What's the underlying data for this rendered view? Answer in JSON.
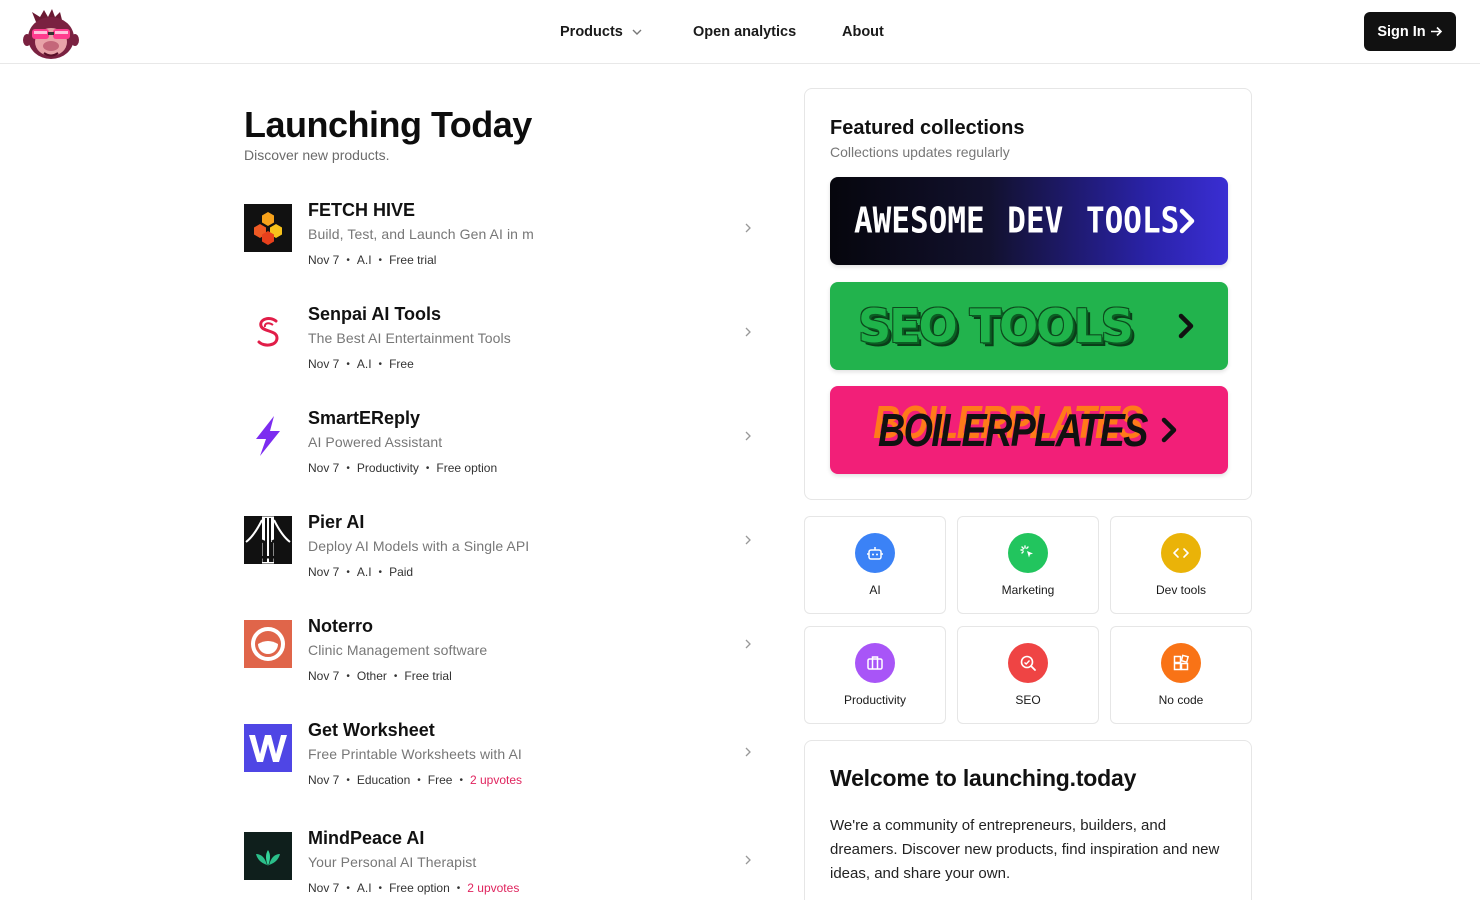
{
  "header": {
    "nav": {
      "products": "Products",
      "analytics": "Open analytics",
      "about": "About"
    },
    "signin": "Sign In"
  },
  "main": {
    "title": "Launching Today",
    "subtitle": "Discover new products.",
    "products": [
      {
        "name": "FETCH HIVE",
        "tagline": "Build, Test, and Launch Gen AI in m",
        "date": "Nov 7",
        "category": "A.I",
        "pricing": "Free trial",
        "upvotes": ""
      },
      {
        "name": "Senpai AI Tools",
        "tagline": "The Best AI Entertainment Tools",
        "date": "Nov 7",
        "category": "A.I",
        "pricing": "Free",
        "upvotes": ""
      },
      {
        "name": "SmartEReply",
        "tagline": "AI Powered Assistant",
        "date": "Nov 7",
        "category": "Productivity",
        "pricing": "Free option",
        "upvotes": ""
      },
      {
        "name": "Pier AI",
        "tagline": "Deploy AI Models with a Single API",
        "date": "Nov 7",
        "category": "A.I",
        "pricing": "Paid",
        "upvotes": ""
      },
      {
        "name": "Noterro",
        "tagline": "Clinic Management software",
        "date": "Nov 7",
        "category": "Other",
        "pricing": "Free trial",
        "upvotes": ""
      },
      {
        "name": "Get Worksheet",
        "tagline": "Free Printable Worksheets with AI",
        "date": "Nov 7",
        "category": "Education",
        "pricing": "Free",
        "upvotes": "2 upvotes"
      },
      {
        "name": "MindPeace AI",
        "tagline": "Your Personal AI Therapist",
        "date": "Nov 7",
        "category": "A.I",
        "pricing": "Free option",
        "upvotes": "2 upvotes"
      }
    ]
  },
  "sidebar": {
    "featured": {
      "title": "Featured collections",
      "subtitle": "Collections updates regularly",
      "banners": [
        "AWESOME DEV TOOLS",
        "SEO TOOLS",
        "BOILERPLATES"
      ]
    },
    "categories": [
      {
        "label": "AI",
        "color": "#3b82f6",
        "icon": "robot-icon"
      },
      {
        "label": "Marketing",
        "color": "#22c55e",
        "icon": "cursor-click-icon"
      },
      {
        "label": "Dev tools",
        "color": "#eab308",
        "icon": "code-icon"
      },
      {
        "label": "Productivity",
        "color": "#a855f7",
        "icon": "briefcase-icon"
      },
      {
        "label": "SEO",
        "color": "#ef4444",
        "icon": "search-icon"
      },
      {
        "label": "No code",
        "color": "#f97316",
        "icon": "blocks-icon"
      }
    ],
    "welcome": {
      "title": "Welcome to launching.today",
      "body": "We're a community of entrepreneurs, builders, and dreamers. Discover new products, find inspiration and new ideas, and share your own."
    }
  },
  "colors": {
    "accent": "#111111",
    "upvote": "#e0245e"
  }
}
